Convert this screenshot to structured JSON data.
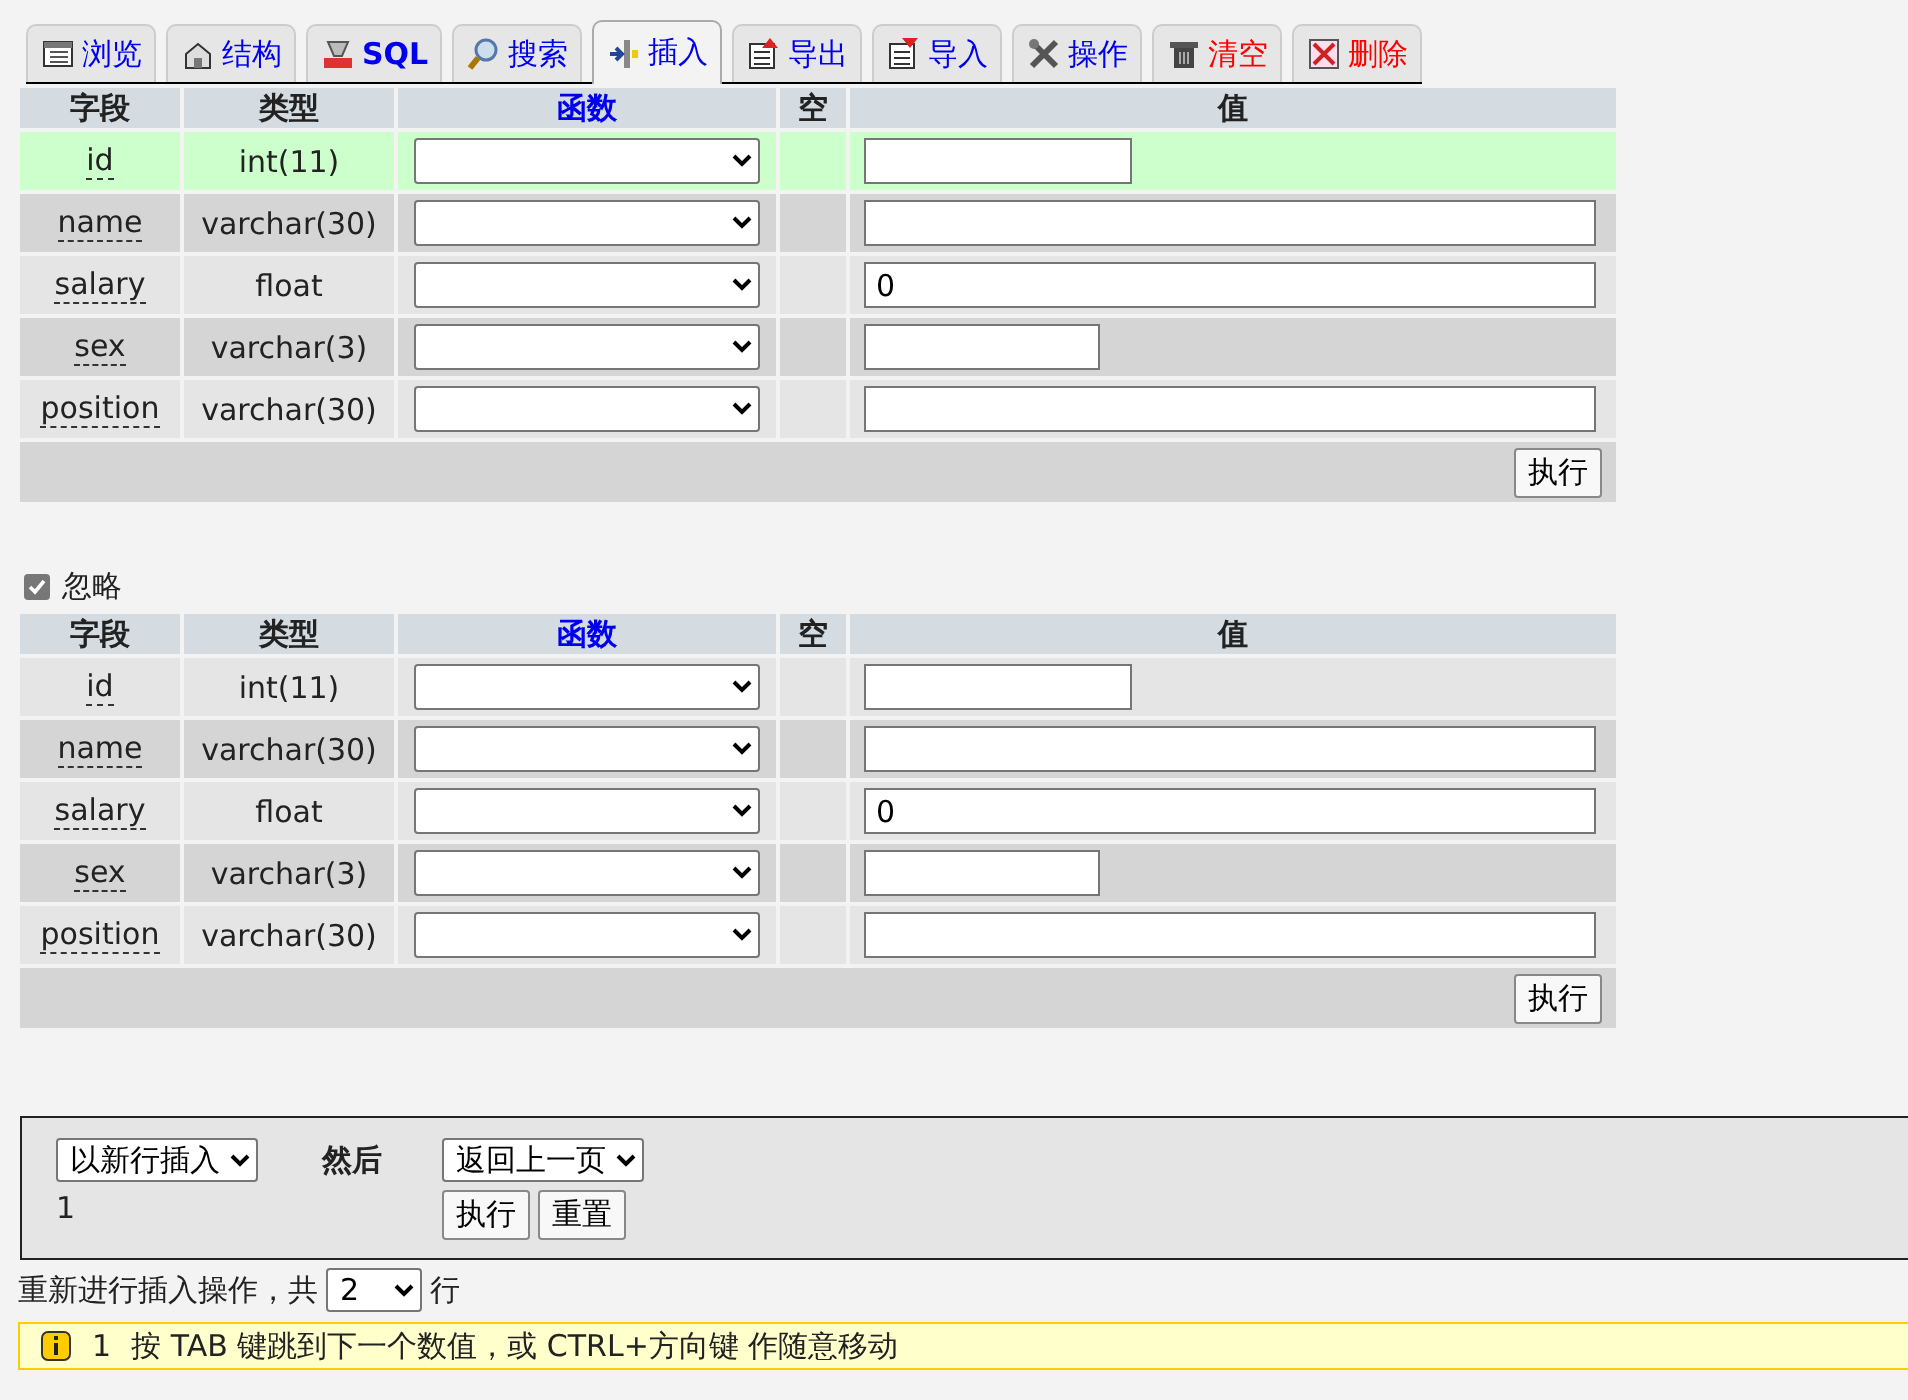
{
  "tabs": [
    {
      "label": "浏览",
      "kind": "normal",
      "selected": false
    },
    {
      "label": "结构",
      "kind": "normal",
      "selected": false
    },
    {
      "label": "SQL",
      "kind": "normal",
      "selected": false
    },
    {
      "label": "搜索",
      "kind": "normal",
      "selected": false
    },
    {
      "label": "插入",
      "kind": "normal",
      "selected": true
    },
    {
      "label": "导出",
      "kind": "normal",
      "selected": false
    },
    {
      "label": "导入",
      "kind": "normal",
      "selected": false
    },
    {
      "label": "操作",
      "kind": "normal",
      "selected": false
    },
    {
      "label": "清空",
      "kind": "danger",
      "selected": false
    },
    {
      "label": "删除",
      "kind": "danger",
      "selected": false
    }
  ],
  "tables": [
    {
      "columns": [
        "字段",
        "类型",
        "函数",
        "空",
        "值"
      ],
      "rows": [
        {
          "field": "id",
          "type": "int(11)",
          "kind": "short",
          "highlighted": true
        },
        {
          "field": "name",
          "type": "varchar(30)",
          "kind": "long",
          "highlighted": false
        },
        {
          "field": "salary",
          "type": "float",
          "kind": "long",
          "value": "0",
          "highlighted": false
        },
        {
          "field": "sex",
          "type": "varchar(3)",
          "kind": "short",
          "highlighted": false
        },
        {
          "field": "position",
          "type": "varchar(30)",
          "kind": "long",
          "highlighted": false
        }
      ],
      "submit": "执行"
    },
    {
      "ignore": {
        "label": "忽略",
        "checked": true
      },
      "columns": [
        "字段",
        "类型",
        "函数",
        "空",
        "值"
      ],
      "rows": [
        {
          "field": "id",
          "type": "int(11)",
          "kind": "short",
          "highlighted": false
        },
        {
          "field": "name",
          "type": "varchar(30)",
          "kind": "long",
          "highlighted": false
        },
        {
          "field": "salary",
          "type": "float",
          "kind": "long",
          "value": "0",
          "highlighted": false
        },
        {
          "field": "sex",
          "type": "varchar(3)",
          "kind": "short",
          "highlighted": false
        },
        {
          "field": "position",
          "type": "varchar(30)",
          "kind": "long",
          "highlighted": false
        }
      ],
      "submit": "执行"
    }
  ],
  "bottom": {
    "insert_mode": "以新行插入",
    "count": "1",
    "then_label": "然后",
    "after": "返回上一页",
    "buttons": [
      "执行",
      "重置"
    ]
  },
  "rerun": {
    "before": "重新进行插入操作，共",
    "value": "2",
    "after": "行"
  },
  "notice": {
    "number": "1",
    "text": "按 TAB 键跳到下一个数值，或 CTRL+方向键 作随意移动"
  }
}
